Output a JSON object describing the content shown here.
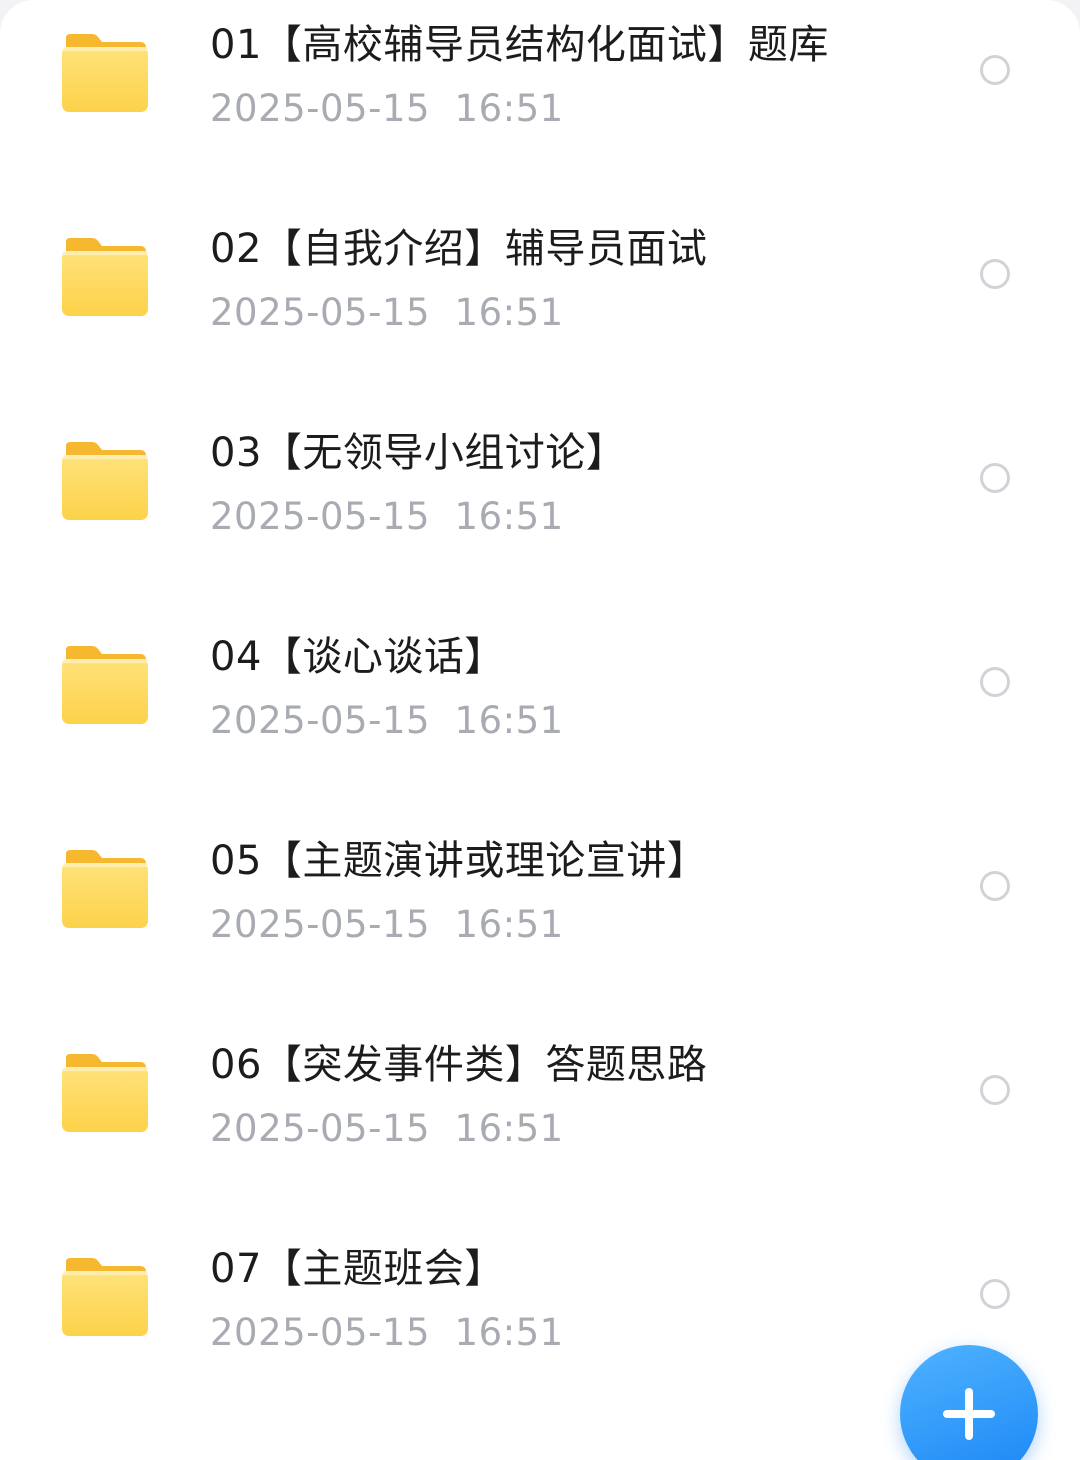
{
  "files": [
    {
      "name": "01【高校辅导员结构化面试】题库",
      "date": "2025-05-15  16:51",
      "icon": "folder-icon"
    },
    {
      "name": "02【自我介绍】辅导员面试",
      "date": "2025-05-15  16:51",
      "icon": "folder-icon"
    },
    {
      "name": "03【无领导小组讨论】",
      "date": "2025-05-15  16:51",
      "icon": "folder-icon"
    },
    {
      "name": "04【谈心谈话】",
      "date": "2025-05-15  16:51",
      "icon": "folder-icon"
    },
    {
      "name": "05【主题演讲或理论宣讲】",
      "date": "2025-05-15  16:51",
      "icon": "folder-icon"
    },
    {
      "name": "06【突发事件类】答题思路",
      "date": "2025-05-15  16:51",
      "icon": "folder-icon"
    },
    {
      "name": "07【主题班会】",
      "date": "2025-05-15  16:51",
      "icon": "folder-icon"
    }
  ],
  "fab": {
    "icon": "plus-icon"
  },
  "colors": {
    "folder": "#fdd24a",
    "accent": "#1b86f5",
    "date_text": "#a9abb3"
  }
}
